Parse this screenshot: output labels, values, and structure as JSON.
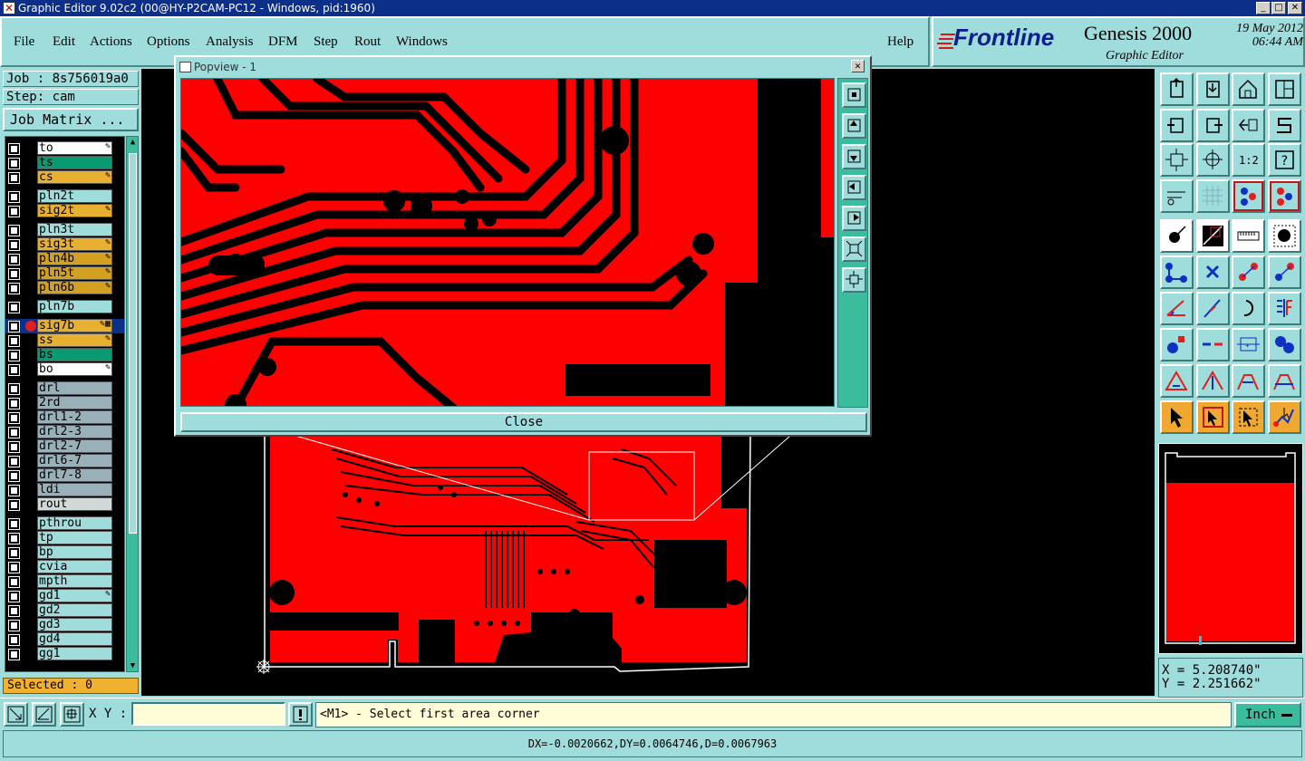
{
  "window": {
    "title": "Graphic Editor 9.02c2 (00@HY-P2CAM-PC12 - Windows, pid:1960)",
    "buttons": [
      "_",
      "□",
      "✕"
    ]
  },
  "menu": {
    "items": [
      "File",
      "Edit",
      "Actions",
      "Options",
      "Analysis",
      "DFM",
      "Step",
      "Rout",
      "Windows"
    ],
    "help": "Help"
  },
  "brand": {
    "logo": "Frontline",
    "product": "Genesis 2000",
    "subtitle": "Graphic Editor",
    "date": "19 May 2012",
    "time": "06:44 AM"
  },
  "job": {
    "job_label": "Job : 8s756019a0",
    "step_label": "Step: cam",
    "matrix_button": "Job Matrix ..."
  },
  "layers": [
    {
      "name": "to",
      "color": "#ffffff",
      "icon": "✎"
    },
    {
      "name": "ts",
      "color": "#0a9a72",
      "icon": ""
    },
    {
      "name": "cs",
      "color": "#e8b030",
      "icon": "✎"
    },
    {
      "name": "pln2t",
      "color": "#9fdcdc",
      "icon": ""
    },
    {
      "name": "sig2t",
      "color": "#e8b030",
      "icon": "✎"
    },
    {
      "name": "pln3t",
      "color": "#9fdcdc",
      "icon": ""
    },
    {
      "name": "sig3t",
      "color": "#e8b030",
      "icon": "✎"
    },
    {
      "name": "pln4b",
      "color": "#d4a020",
      "icon": "✎"
    },
    {
      "name": "pln5t",
      "color": "#d4a020",
      "icon": "✎"
    },
    {
      "name": "pln6b",
      "color": "#d4a020",
      "icon": "✎"
    },
    {
      "name": "pln7b",
      "color": "#9fdcdc",
      "icon": ""
    },
    {
      "name": "sig7b",
      "color": "#e8b030",
      "icon": "✎▦"
    },
    {
      "name": "ss",
      "color": "#e8b030",
      "icon": "✎"
    },
    {
      "name": "bs",
      "color": "#0a9a72",
      "icon": ""
    },
    {
      "name": "bo",
      "color": "#ffffff",
      "icon": "✎"
    },
    {
      "name": "drl",
      "color": "#9ab0b8",
      "icon": ""
    },
    {
      "name": "2rd",
      "color": "#9ab0b8",
      "icon": ""
    },
    {
      "name": "drl1-2",
      "color": "#9ab0b8",
      "icon": ""
    },
    {
      "name": "drl2-3",
      "color": "#9ab0b8",
      "icon": ""
    },
    {
      "name": "drl2-7",
      "color": "#9ab0b8",
      "icon": ""
    },
    {
      "name": "drl6-7",
      "color": "#9ab0b8",
      "icon": ""
    },
    {
      "name": "drl7-8",
      "color": "#9ab0b8",
      "icon": ""
    },
    {
      "name": "ldi",
      "color": "#9ab0b8",
      "icon": ""
    },
    {
      "name": "rout",
      "color": "#d0d8d8",
      "icon": ""
    },
    {
      "name": "pthrou",
      "color": "#9fdcdc",
      "icon": ""
    },
    {
      "name": "tp",
      "color": "#9fdcdc",
      "icon": ""
    },
    {
      "name": "bp",
      "color": "#9fdcdc",
      "icon": ""
    },
    {
      "name": "cvia",
      "color": "#9fdcdc",
      "icon": ""
    },
    {
      "name": "mpth",
      "color": "#9fdcdc",
      "icon": ""
    },
    {
      "name": "gd1",
      "color": "#9fdcdc",
      "icon": "✎"
    },
    {
      "name": "gd2",
      "color": "#9fdcdc",
      "icon": ""
    },
    {
      "name": "gd3",
      "color": "#9fdcdc",
      "icon": ""
    },
    {
      "name": "gd4",
      "color": "#9fdcdc",
      "icon": ""
    },
    {
      "name": "gg1",
      "color": "#9fdcdc",
      "icon": ""
    }
  ],
  "selected_label": "Selected : 0",
  "popview": {
    "title": "Popview - 1",
    "close_button": "Close",
    "close_x": "✕"
  },
  "coords": {
    "x": "X = 5.208740\"",
    "y": "Y = 2.251662\""
  },
  "command": {
    "xy_label": "X Y :",
    "xy_value": "",
    "prompt": "<M1> - Select first area corner",
    "units": "Inch"
  },
  "status": "DX=-0.0020662,DY=0.0064746,D=0.0067963",
  "colors": {
    "accent": "#9fdcdc",
    "board": "#ff0000",
    "title_bar": "#0c2f8a",
    "highlight": "#f0a830"
  }
}
